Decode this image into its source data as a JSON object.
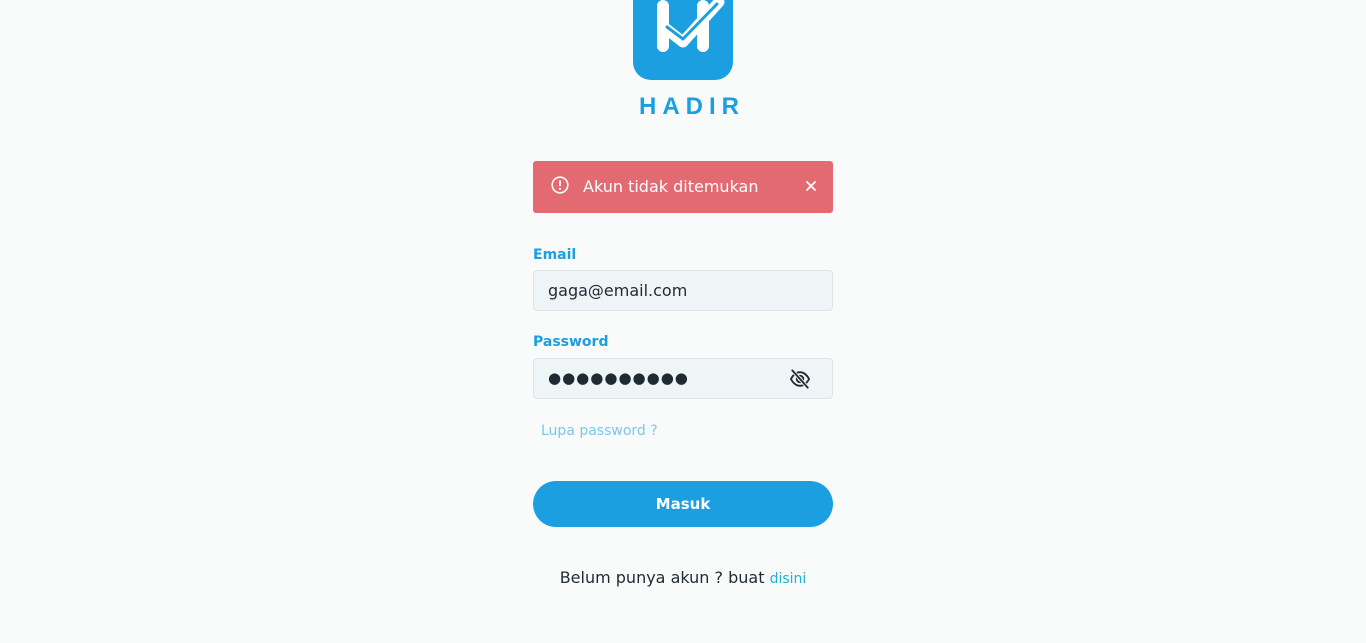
{
  "brand": {
    "name": "HADIR",
    "logo_icon": "hadir-logo-icon",
    "color": "#1b9fe0"
  },
  "alert": {
    "message": "Akun tidak ditemukan",
    "icon": "exclamation-circle-icon",
    "close_icon": "close-icon",
    "color": "#e46a72"
  },
  "form": {
    "email": {
      "label": "Email",
      "value": "gaga@email.com"
    },
    "password": {
      "label": "Password",
      "value": "●●●●●●●●●●",
      "toggle_icon": "eye-slash-icon"
    },
    "forgot_link": "Lupa password ?",
    "submit_label": "Masuk"
  },
  "signup": {
    "prompt": "Belum punya akun ? buat",
    "link": "disini"
  }
}
